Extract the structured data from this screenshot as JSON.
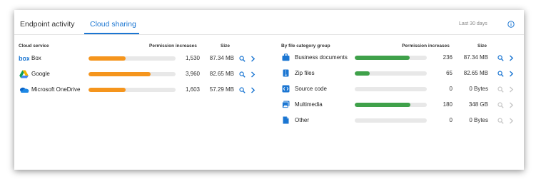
{
  "tabs": [
    {
      "label": "Endpoint  activity",
      "active": false
    },
    {
      "label": "Cloud sharing",
      "active": true
    }
  ],
  "time_range": "Last 30 days",
  "colors": {
    "accent": "#1b76d2",
    "orange": "#f5951d",
    "green": "#3fa14a",
    "track": "#e8e8e8",
    "disabled": "#c7c7c7"
  },
  "cloud": {
    "headers": {
      "service": "Cloud service",
      "permission": "Permission increases",
      "size": "Size"
    },
    "rows": [
      {
        "name": "Box",
        "icon": "box-logo-icon",
        "count": "1,530",
        "fraction": 0.43,
        "size": "87.34 MB"
      },
      {
        "name": "Google",
        "icon": "google-drive-icon",
        "count": "3,960",
        "fraction": 0.71,
        "size": "82.65 MB"
      },
      {
        "name": "Microsoft OneDrive",
        "icon": "onedrive-icon",
        "count": "1,603",
        "fraction": 0.43,
        "size": "57.29 MB"
      }
    ]
  },
  "files": {
    "headers": {
      "group": "By file category group",
      "permission": "Permission increases",
      "size": "Size"
    },
    "rows": [
      {
        "name": "Business documents",
        "icon": "briefcase-icon",
        "count": "236",
        "fraction": 0.76,
        "size": "87.34 MB",
        "enabled": true
      },
      {
        "name": "Zip files",
        "icon": "zip-file-icon",
        "count": "65",
        "fraction": 0.21,
        "size": "82.65 MB",
        "enabled": true
      },
      {
        "name": "Source code",
        "icon": "source-code-icon",
        "count": "0",
        "fraction": 0,
        "size": "0 Bytes",
        "enabled": false
      },
      {
        "name": "Multimedia",
        "icon": "multimedia-icon",
        "count": "180",
        "fraction": 0.77,
        "size": "348 GB",
        "enabled": false
      },
      {
        "name": "Other",
        "icon": "document-icon",
        "count": "0",
        "fraction": 0,
        "size": "0 Bytes",
        "enabled": false
      }
    ]
  }
}
